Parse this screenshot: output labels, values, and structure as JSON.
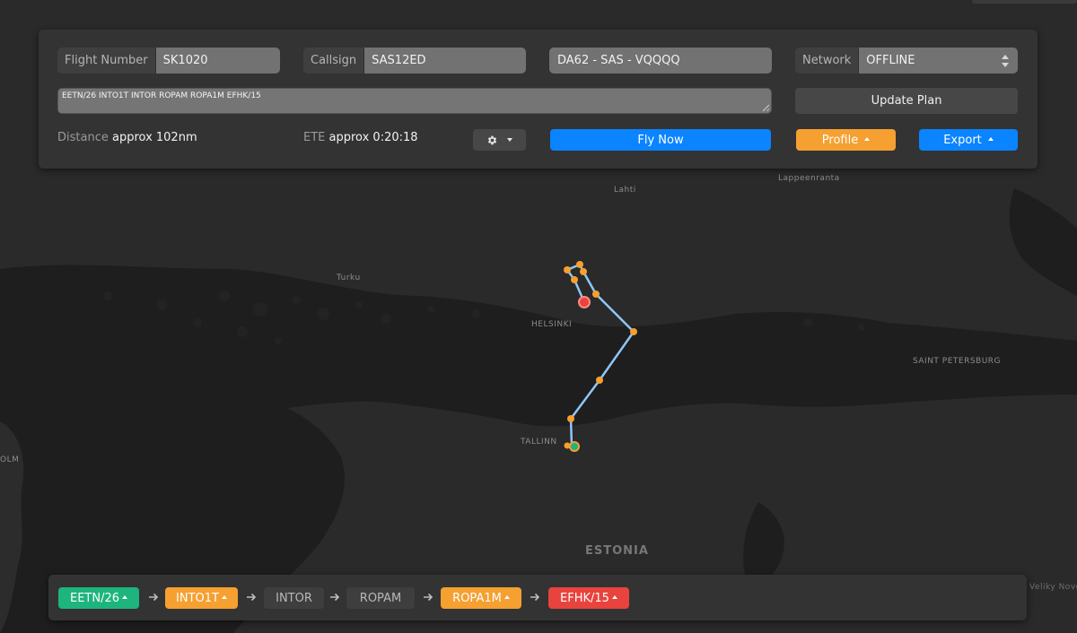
{
  "form": {
    "flight_number_label": "Flight Number",
    "flight_number_value": "SK1020",
    "callsign_label": "Callsign",
    "callsign_value": "SAS12ED",
    "aircraft_value": "DA62 - SAS - VQQQQ",
    "network_label": "Network",
    "network_value": "OFFLINE",
    "route_value": "EETN/26 INTO1T INTOR ROPAM ROPA1M EFHK/15",
    "update_plan_label": "Update Plan",
    "distance_label": "Distance",
    "distance_value": "approx 102nm",
    "ete_label": "ETE",
    "ete_value": "approx 0:20:18",
    "fly_now_label": "Fly Now",
    "profile_label": "Profile",
    "export_label": "Export"
  },
  "map": {
    "labels": {
      "lahti": "Lahti",
      "lappeenranta": "Lappeenranta",
      "turku": "Turku",
      "helsinki": "HELSINKI",
      "saint_petersburg": "SAINT PETERSBURG",
      "tallinn": "TALLINN",
      "estonia": "ESTONIA",
      "olm": "OLM",
      "velikiy_novgorod": "Veliky Novgor"
    },
    "route_color": "#8ec6f5",
    "waypoint_color": "#f5a031",
    "origin_color": "#1db47e",
    "destination_color": "#e8433d"
  },
  "waypoints": [
    {
      "label": "EETN/26",
      "color": "green",
      "has_caret": true
    },
    {
      "label": "INTO1T",
      "color": "orange",
      "has_caret": true
    },
    {
      "label": "INTOR",
      "color": "grey",
      "has_caret": false
    },
    {
      "label": "ROPAM",
      "color": "grey",
      "has_caret": false
    },
    {
      "label": "ROPA1M",
      "color": "orange",
      "has_caret": true
    },
    {
      "label": "EFHK/15",
      "color": "red",
      "has_caret": true
    }
  ]
}
